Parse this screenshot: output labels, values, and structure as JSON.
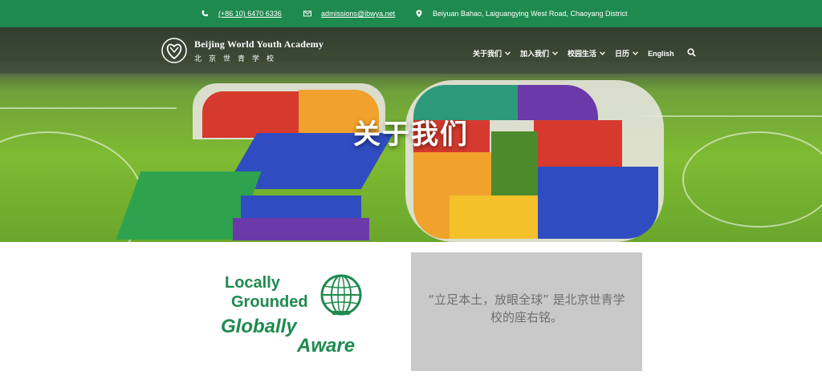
{
  "topbar": {
    "phone": "(+86 10) 6470 6336",
    "email": "admissions@ibwya.net",
    "address": "Beiyuan Bahao, Laiguangying West Road, Chaoyang District",
    "phone_icon": "phone-icon",
    "email_icon": "envelope-icon",
    "address_icon": "map-pin-icon"
  },
  "header": {
    "logo_en": "Beijing World Youth Academy",
    "logo_cn": "北京世青学校",
    "nav": [
      {
        "label": "关于我们"
      },
      {
        "label": "加入我们"
      },
      {
        "label": "校园生活"
      },
      {
        "label": "日历"
      },
      {
        "label": "English"
      }
    ]
  },
  "hero": {
    "title": "关于我们"
  },
  "motto": {
    "line1": "Locally",
    "line2": "Grounded",
    "line3": "Globally",
    "line4": "Aware"
  },
  "quote": {
    "text": "“立足本土，放眼全球” 是北京世青学校的座右铭。"
  },
  "colors": {
    "brand_green": "#1e8a4e",
    "quote_bg": "#c9c9c9"
  }
}
